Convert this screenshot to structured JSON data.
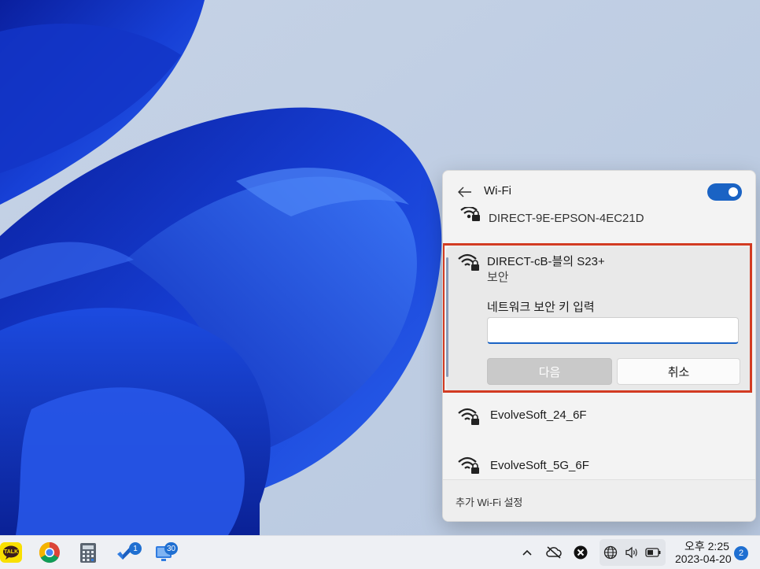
{
  "wifi_panel": {
    "title": "Wi-Fi",
    "toggle_on": true,
    "partial_network": {
      "ssid": "DIRECT-9E-EPSON-4EC21D"
    },
    "selected_network": {
      "ssid": "DIRECT-cB-블의 S23+",
      "security": "보안",
      "key_label": "네트워크 보안 키 입력",
      "key_value": "",
      "next_label": "다음",
      "cancel_label": "취소"
    },
    "networks": [
      {
        "ssid": "EvolveSoft_24_6F",
        "secured": true
      },
      {
        "ssid": "EvolveSoft_5G_6F",
        "secured": true
      }
    ],
    "more_settings": "추가 Wi-Fi 설정",
    "accent_color": "#1a63c4",
    "highlight_color": "#d23b22"
  },
  "taskbar": {
    "apps": [
      {
        "name": "KakaoTalk",
        "icon_text": "TALK"
      },
      {
        "name": "Chrome"
      },
      {
        "name": "Calculator"
      },
      {
        "name": "To Do",
        "badge": "1"
      },
      {
        "name": "Remote Desktop",
        "badge": "30"
      }
    ],
    "tray": {
      "clock_time": "오후 2:25",
      "clock_date": "2023-04-20",
      "notification_count": "2"
    }
  }
}
